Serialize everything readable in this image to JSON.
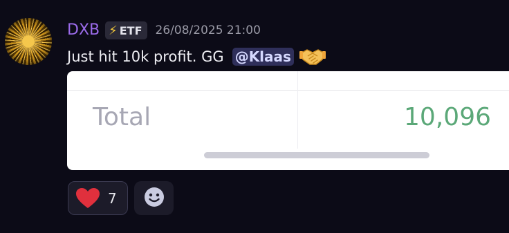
{
  "message": {
    "username": "DXB",
    "tag": {
      "icon": "lightning-bolt-icon",
      "glyph": "⚡",
      "label": "ETF"
    },
    "timestamp": "26/08/2025 21:00",
    "text": "Just hit 10k profit. GG",
    "mention": "@Klaas",
    "emoji": "handshake-emoji"
  },
  "embed": {
    "row_label": "Total",
    "row_value": "10,096"
  },
  "reactions": [
    {
      "icon": "heart-icon",
      "count": "7"
    }
  ],
  "add_reaction": {
    "icon": "smiley-add-reaction-icon"
  },
  "colors": {
    "username": "#9b6bea",
    "value": "#5ba878",
    "background": "#0c0b17"
  }
}
